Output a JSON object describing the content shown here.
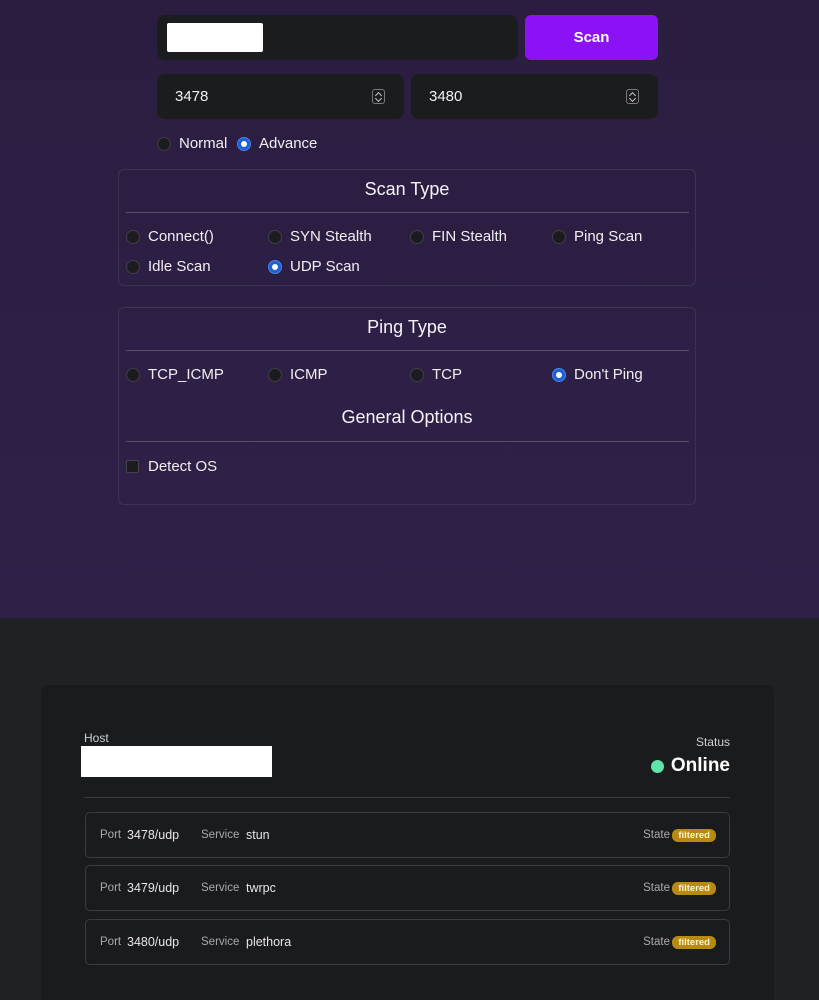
{
  "scan_form": {
    "scan_button": "Scan",
    "port_start": "3478",
    "port_end": "3480",
    "mode_options": [
      {
        "label": "Normal",
        "selected": false
      },
      {
        "label": "Advance",
        "selected": true
      }
    ]
  },
  "scan_type": {
    "title": "Scan Type",
    "options": [
      {
        "label": "Connect()",
        "selected": false
      },
      {
        "label": "SYN Stealth",
        "selected": false
      },
      {
        "label": "FIN Stealth",
        "selected": false
      },
      {
        "label": "Ping Scan",
        "selected": false
      },
      {
        "label": "Idle Scan",
        "selected": false
      },
      {
        "label": "UDP Scan",
        "selected": true
      }
    ]
  },
  "ping_type": {
    "title": "Ping Type",
    "options": [
      {
        "label": "TCP_ICMP",
        "selected": false
      },
      {
        "label": "ICMP",
        "selected": false
      },
      {
        "label": "TCP",
        "selected": false
      },
      {
        "label": "Don't Ping",
        "selected": true
      }
    ]
  },
  "general_options": {
    "title": "General Options",
    "detect_os_label": "Detect OS",
    "detect_os_checked": false
  },
  "results": {
    "host_label": "Host",
    "status_label": "Status",
    "status_value": "Online",
    "status_color": "#5ee3a8",
    "port_key": "Port",
    "service_key": "Service",
    "state_key": "State",
    "rows": [
      {
        "port": "3478/udp",
        "service": "stun",
        "state": "filtered"
      },
      {
        "port": "3479/udp",
        "service": "twrpc",
        "state": "filtered"
      },
      {
        "port": "3480/udp",
        "service": "plethora",
        "state": "filtered"
      }
    ]
  },
  "colors": {
    "accent": "#8b12f5",
    "radio_selected": "#1d5fd6",
    "badge": "#b88a12"
  }
}
